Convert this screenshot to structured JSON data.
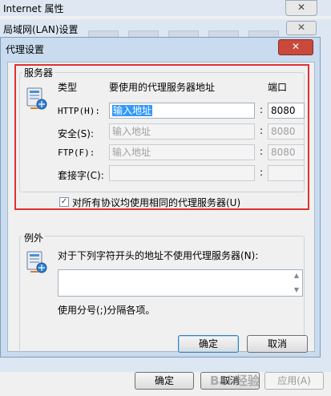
{
  "internet_properties": {
    "title": "Internet 属性",
    "close_label": "✕",
    "buttons": {
      "ok": "确定",
      "cancel": "取消",
      "apply": "应用(A)"
    }
  },
  "lan_settings": {
    "title": "局域网(LAN)设置",
    "close_label": "✕"
  },
  "proxy_settings": {
    "title": "代理设置",
    "close_label": "✕",
    "servers": {
      "group_label": "服务器",
      "col_type": "类型",
      "col_address": "要使用的代理服务器地址",
      "col_port": "端口",
      "rows": [
        {
          "label": "HTTP(H):",
          "address": "输入地址",
          "port": "8080",
          "enabled": true,
          "selected": true
        },
        {
          "label": "安全(S):",
          "address": "输入地址",
          "port": "8080",
          "enabled": false
        },
        {
          "label": "FTP(F):",
          "address": "输入地址",
          "port": "8080",
          "enabled": false
        },
        {
          "label": "套接字(C):",
          "address": "",
          "port": "",
          "enabled": false
        }
      ],
      "same_proxy_label": "对所有协议均使用相同的代理服务器(U)",
      "same_proxy_checked": true
    },
    "exceptions": {
      "group_label": "例外",
      "description": "对于下列字符开头的地址不使用代理服务器(N):",
      "value": "",
      "hint": "使用分号(;)分隔各项。"
    },
    "buttons": {
      "ok": "确定",
      "cancel": "取消"
    }
  },
  "watermark": "Bai 经验",
  "colors": {
    "highlight_frame": "#e03131",
    "selection": "#3399ff",
    "close_red": "#c94a3b"
  }
}
